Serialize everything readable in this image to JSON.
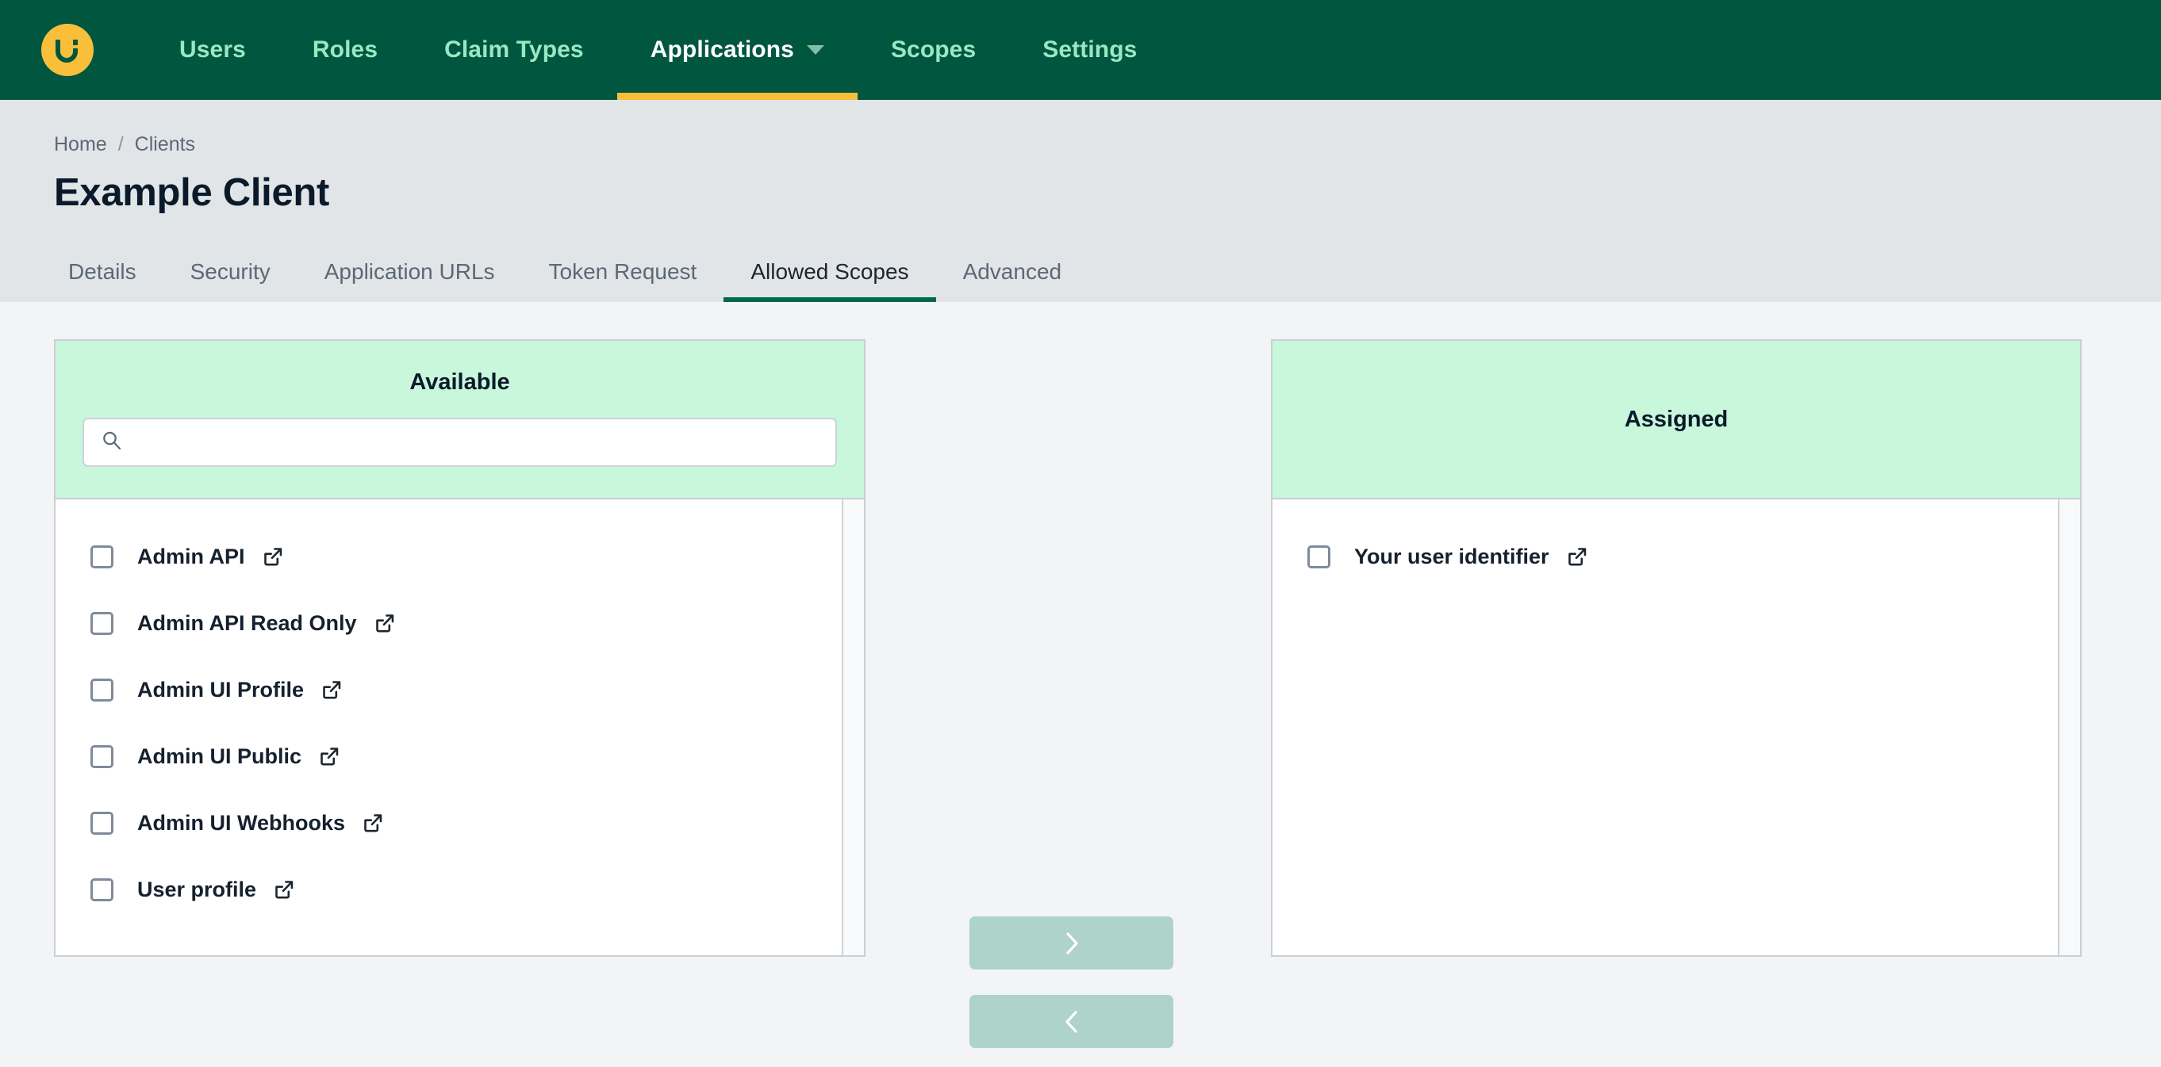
{
  "brand": {
    "logo_icon": "ui-circle-logo",
    "logo_letter": "Ui",
    "nav_bg": "#00563f",
    "accent_yellow": "#f9bf3b",
    "nav_link_color": "#9ae8c3",
    "panel_header_green": "#c8f7dc",
    "tab_underline_green": "#00694c",
    "transfer_button_color": "#aed3c8"
  },
  "topnav": {
    "items": [
      {
        "label": "Users",
        "active": false,
        "has_caret": false
      },
      {
        "label": "Roles",
        "active": false,
        "has_caret": false
      },
      {
        "label": "Claim Types",
        "active": false,
        "has_caret": false
      },
      {
        "label": "Applications",
        "active": true,
        "has_caret": true
      },
      {
        "label": "Scopes",
        "active": false,
        "has_caret": false
      },
      {
        "label": "Settings",
        "active": false,
        "has_caret": false
      }
    ]
  },
  "breadcrumb": {
    "home": "Home",
    "separator": "/",
    "current": "Clients"
  },
  "page": {
    "title": "Example Client"
  },
  "tabs": {
    "items": [
      {
        "label": "Details",
        "active": false
      },
      {
        "label": "Security",
        "active": false
      },
      {
        "label": "Application URLs",
        "active": false
      },
      {
        "label": "Token Request",
        "active": false
      },
      {
        "label": "Allowed Scopes",
        "active": true
      },
      {
        "label": "Advanced",
        "active": false
      }
    ]
  },
  "available_panel": {
    "title": "Available",
    "search": {
      "value": "",
      "placeholder": "",
      "icon": "search-icon"
    },
    "items": [
      {
        "label": "Admin API",
        "checked": false,
        "link_icon": "external-link-icon"
      },
      {
        "label": "Admin API Read Only",
        "checked": false,
        "link_icon": "external-link-icon"
      },
      {
        "label": "Admin UI Profile",
        "checked": false,
        "link_icon": "external-link-icon"
      },
      {
        "label": "Admin UI Public",
        "checked": false,
        "link_icon": "external-link-icon"
      },
      {
        "label": "Admin UI Webhooks",
        "checked": false,
        "link_icon": "external-link-icon"
      },
      {
        "label": "User profile",
        "checked": false,
        "link_icon": "external-link-icon"
      }
    ]
  },
  "assigned_panel": {
    "title": "Assigned",
    "items": [
      {
        "label": "Your user identifier",
        "checked": false,
        "link_icon": "external-link-icon"
      }
    ]
  },
  "transfer": {
    "assign_icon": "chevron-right-icon",
    "unassign_icon": "chevron-left-icon"
  }
}
